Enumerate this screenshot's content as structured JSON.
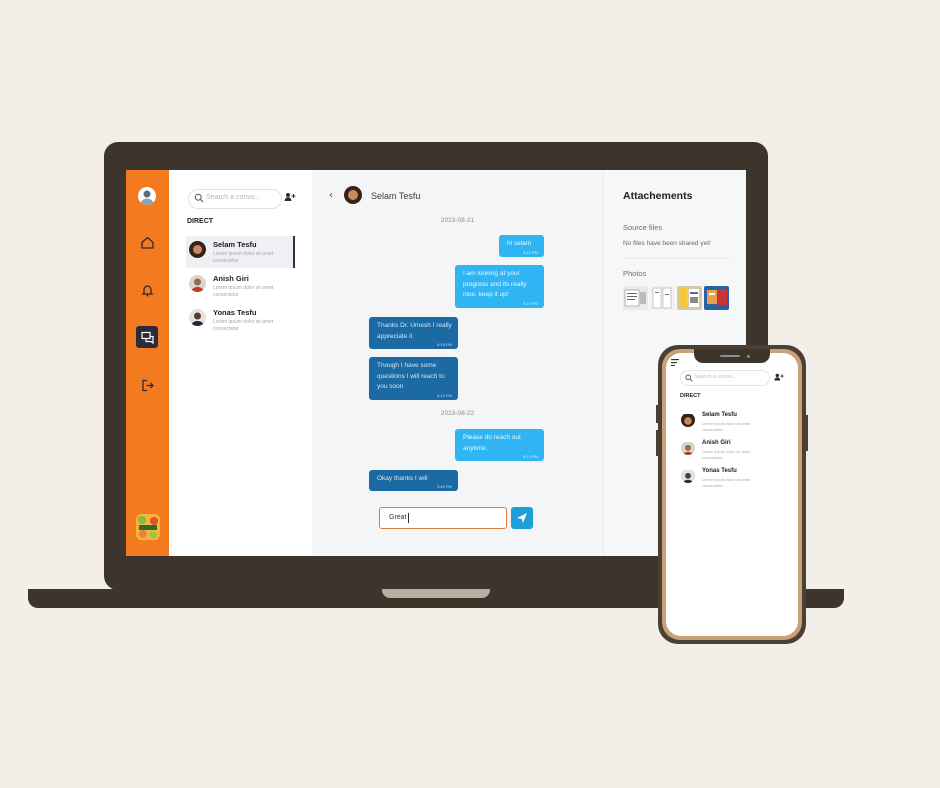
{
  "colors": {
    "rail": "#f47a1f",
    "rail_active": "#2b2b3a",
    "bubble_out": "#30b5f4",
    "bubble_in": "#1b6aa3",
    "send_button": "#1d9fd8",
    "compose_border": "#e07a3a",
    "device_frame": "#3d342c",
    "background": "#f3efe8"
  },
  "rail": {
    "icons": [
      "user-avatar",
      "home-icon",
      "bell-icon",
      "chat-icon",
      "logout-icon"
    ],
    "active": "chat-icon",
    "brand": "brand-logo"
  },
  "search": {
    "placeholder": "Search a convo..."
  },
  "section_label": "DIRECT",
  "conversations": [
    {
      "name": "Selam Tesfu",
      "preview": "Lorem ipsum dolor sit amet consectetur",
      "active": true
    },
    {
      "name": "Anish Giri",
      "preview": "Lorem ipsum dolor sit amet consectetur",
      "active": false
    },
    {
      "name": "Yonas Tesfu",
      "preview": "Lorem ipsum dolor sit amet consectetur",
      "active": false
    }
  ],
  "chat": {
    "contact_name": "Selam Tesfu",
    "dates": [
      "2023-08-21",
      "2023-08-22"
    ],
    "messages": [
      {
        "dir": "out",
        "text": "hi selam",
        "time": "6:12 PM"
      },
      {
        "dir": "out",
        "text": "I am looking at your progress and its really nice, keep it up!",
        "time": "6:15 PM"
      },
      {
        "dir": "in",
        "text": "Thanks Dr. Umesh I really appreciate it",
        "time": "6:18 PM"
      },
      {
        "dir": "in",
        "text": "Though I have some questions I will reach to you soon",
        "time": "6:12 PM"
      },
      {
        "dir": "out",
        "text": "Please do reach out anytime.",
        "time": "6:14 PM"
      },
      {
        "dir": "in",
        "text": "Okay thanks I will",
        "time": "3:45 PM"
      }
    ],
    "compose_value": "Great",
    "send_icon": "send-icon"
  },
  "attachments": {
    "title": "Attachements",
    "source_files_label": "Source files",
    "no_files_text": "No files have been shared yet!",
    "photos_label": "Photos",
    "photos": [
      "photo-1",
      "photo-2",
      "photo-3",
      "photo-4"
    ]
  },
  "phone": {
    "search_placeholder": "Search a convo...",
    "section_label": "DIRECT"
  }
}
